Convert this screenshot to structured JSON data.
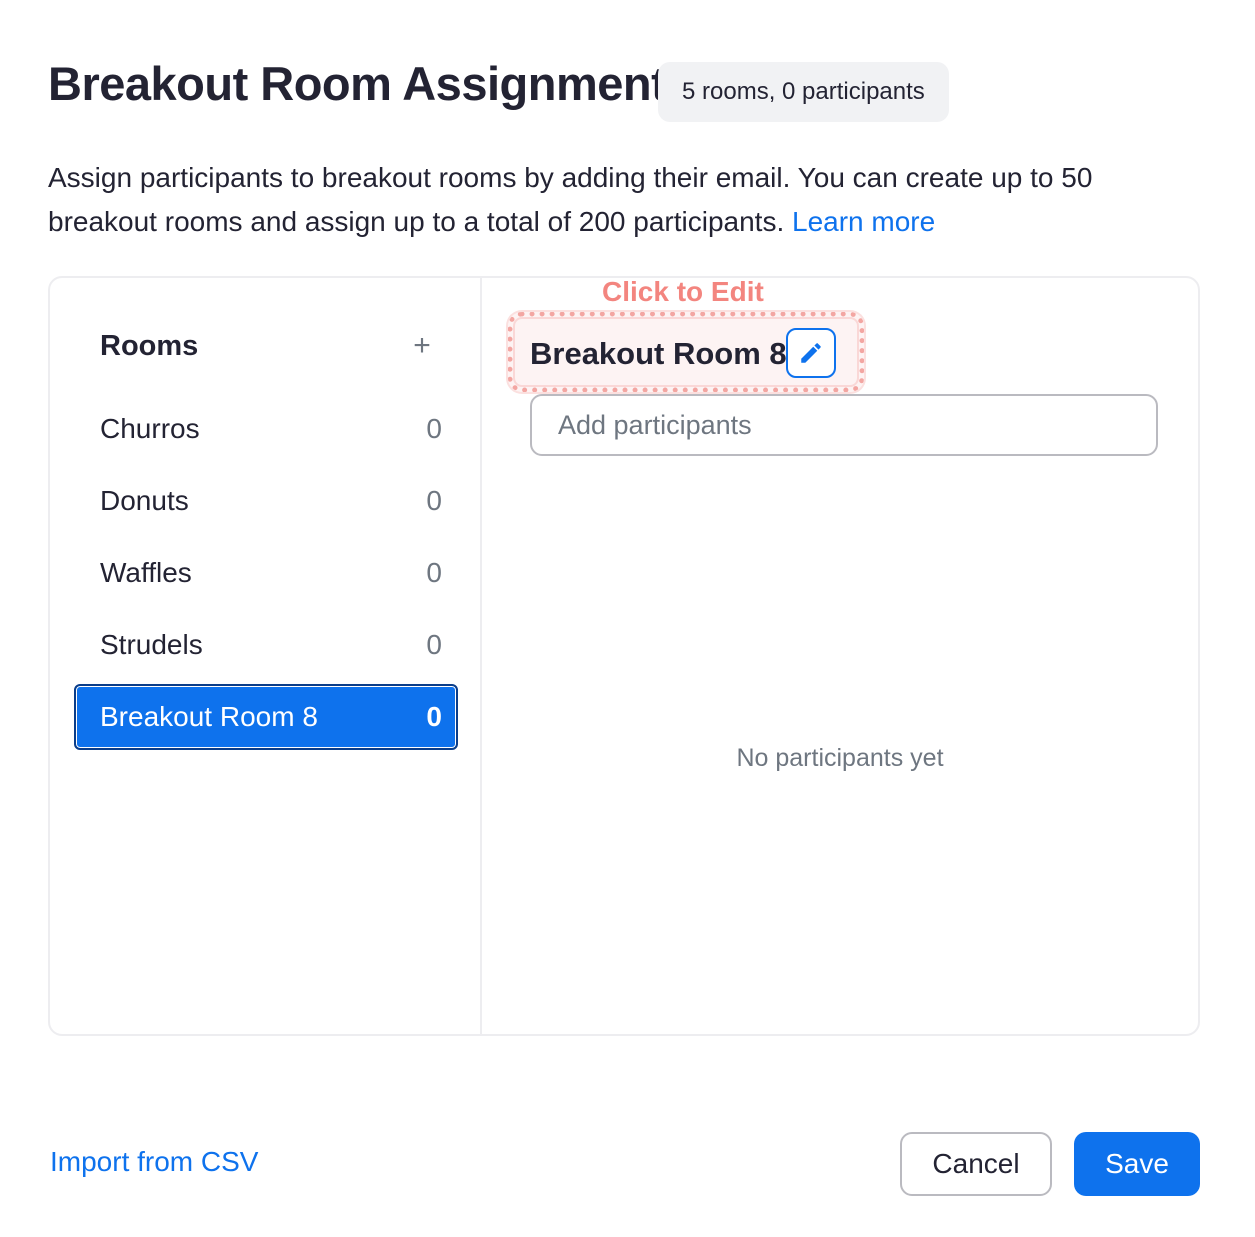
{
  "header": {
    "title": "Breakout Room Assignment",
    "summary": "5 rooms, 0 participants"
  },
  "description": {
    "text": "Assign participants to breakout rooms by adding their email. You can create up to 50 breakout rooms and assign up to a total of 200 participants.",
    "learn_more": "Learn more"
  },
  "sidebar": {
    "heading": "Rooms",
    "add_glyph": "+",
    "rooms": [
      {
        "name": "Churros",
        "count": "0"
      },
      {
        "name": "Donuts",
        "count": "0"
      },
      {
        "name": "Waffles",
        "count": "0"
      },
      {
        "name": "Strudels",
        "count": "0"
      },
      {
        "name": "Breakout Room 8",
        "count": "0",
        "selected": true
      }
    ]
  },
  "detail": {
    "annotation": "Click to Edit",
    "room_name": "Breakout Room 8",
    "add_placeholder": "Add participants",
    "empty_message": "No participants yet"
  },
  "footer": {
    "import_label": "Import from CSV",
    "cancel_label": "Cancel",
    "save_label": "Save"
  },
  "colors": {
    "accent": "#0e72ed",
    "annotation": "#f3857f"
  },
  "icons": {
    "add": "plus-icon",
    "edit": "pencil-icon"
  }
}
